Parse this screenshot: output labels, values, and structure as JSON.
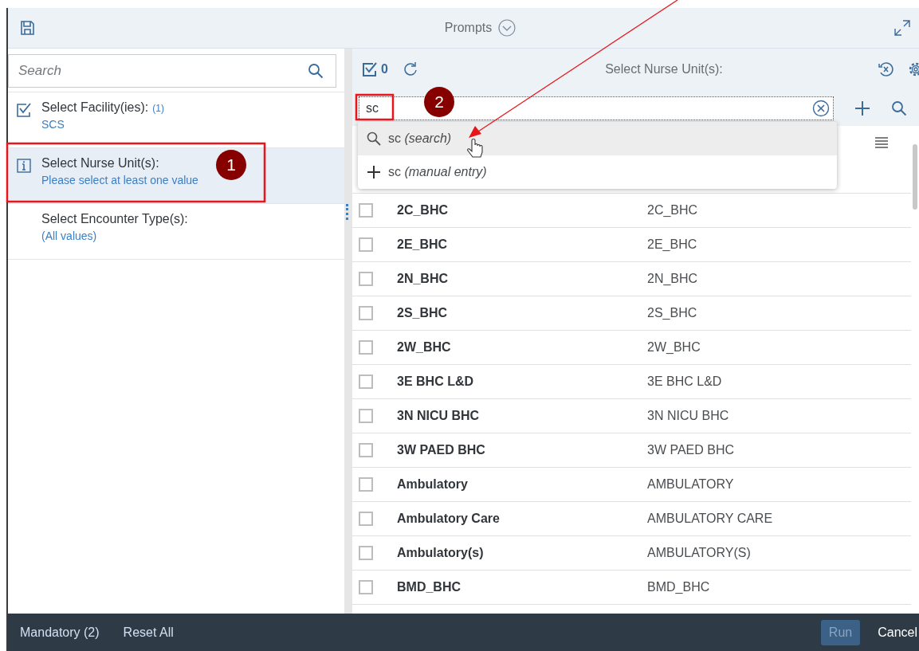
{
  "window": {
    "title": "Prompts"
  },
  "sidebar": {
    "search": {
      "placeholder": "Search"
    },
    "items": [
      {
        "kind": "done",
        "title": "Select Facility(ies):",
        "count": "(1)",
        "value": "SCS",
        "selected": false
      },
      {
        "kind": "info",
        "title": "Select Nurse Unit(s):",
        "value": "Please select at least one value",
        "selected": true
      },
      {
        "kind": "none",
        "title": "Select Encounter Type(s):",
        "value": "(All values)",
        "selected": false
      }
    ]
  },
  "panel": {
    "selected_count": "0",
    "title": "Select Nurse Unit(s):",
    "search": {
      "value": "sc"
    },
    "suggestions": [
      {
        "kind": "search",
        "text": "sc *(search)*",
        "selected": true
      },
      {
        "kind": "manual",
        "text": "sc *(manual entry)*",
        "selected": false
      }
    ],
    "rows": [
      {
        "name": "2C_BHC",
        "key": "2C_BHC",
        "checked": false
      },
      {
        "name": "2E_BHC",
        "key": "2E_BHC",
        "checked": false
      },
      {
        "name": "2N_BHC",
        "key": "2N_BHC",
        "checked": false
      },
      {
        "name": "2S_BHC",
        "key": "2S_BHC",
        "checked": false
      },
      {
        "name": "2W_BHC",
        "key": "2W_BHC",
        "checked": false
      },
      {
        "name": "3E BHC L&D",
        "key": "3E BHC L&D",
        "checked": false
      },
      {
        "name": "3N NICU BHC",
        "key": "3N NICU BHC",
        "checked": false
      },
      {
        "name": "3W PAED BHC",
        "key": "3W PAED BHC",
        "checked": false
      },
      {
        "name": "Ambulatory",
        "key": "AMBULATORY",
        "checked": false
      },
      {
        "name": "Ambulatory Care",
        "key": "AMBULATORY CARE",
        "checked": false
      },
      {
        "name": "Ambulatory(s)",
        "key": "AMBULATORY(S)",
        "checked": false
      },
      {
        "name": "BMD_BHC",
        "key": "BMD_BHC",
        "checked": false
      }
    ]
  },
  "annotations": [
    {
      "label": "1"
    },
    {
      "label": "2"
    }
  ],
  "footer": {
    "links": [
      "Mandatory (2)",
      "Reset All"
    ],
    "buttons": [
      {
        "label": "Run",
        "disabled": true
      },
      {
        "label": "Cancel",
        "disabled": false
      }
    ]
  }
}
